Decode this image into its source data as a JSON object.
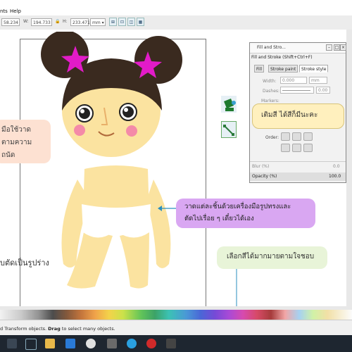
{
  "menu": {
    "items": [
      "nts",
      "Help"
    ]
  },
  "toolbar": {
    "x_value": "58.234",
    "w_label": "W:",
    "w_value": "194.733",
    "lock": "🔒",
    "h_label": "H:",
    "h_value": "233.471",
    "unit": "mm",
    "unit_arrow": "▾"
  },
  "canvas": {
    "bubble_left_line1": "มือใช้วาด",
    "bubble_left_line2": "ตามความถนัด",
    "bubble_right_top": "เติมสี ได้สีก็มีนะคะ",
    "bubble_purple_line1": "วาดแต่ละชิ้นด้วยเครื่องมือรูปทรงและ",
    "bubble_purple_line2": "ตัดไปเรื่อย ๆ เดี๋ยวได้เอง",
    "text_bottom_left": "ับตัดเป็นรูปร่าง",
    "bubble_green": "เลือกสีได้มากมายตามใจชอบ"
  },
  "panel": {
    "title": "Fill and Stro...",
    "header": "Fill and Stroke (Shift+Ctrl+F)",
    "tab_fill": "Fill",
    "tab_stroke_paint": "Stroke paint",
    "tab_stroke_style": "Stroke style",
    "width_label": "Width:",
    "width_value": "0.000",
    "width_unit": "mm",
    "dashes_label": "Dashes:",
    "dashes_value": "0.00",
    "markers_label": "Markers:",
    "order_label": "Order:",
    "blur_label": "Blur (%)",
    "blur_value": "0.0",
    "opacity_label": "Opacity (%)",
    "opacity_value": "100.0"
  },
  "status": {
    "text_prefix": "d Transform objects. ",
    "drag_bold": "Drag",
    "text_suffix": " to select many objects."
  },
  "colors": {
    "skin": "#fbe3a0",
    "hair": "#3a2a1f",
    "star": "#e21bc8",
    "cheek": "#f48aa8",
    "bubble_orange": "#fde1d2",
    "bubble_yellow": "#fff0be",
    "bubble_purple": "#d9a7f2",
    "bubble_green": "#e8f4d8",
    "connector": "#2a8fbf"
  }
}
